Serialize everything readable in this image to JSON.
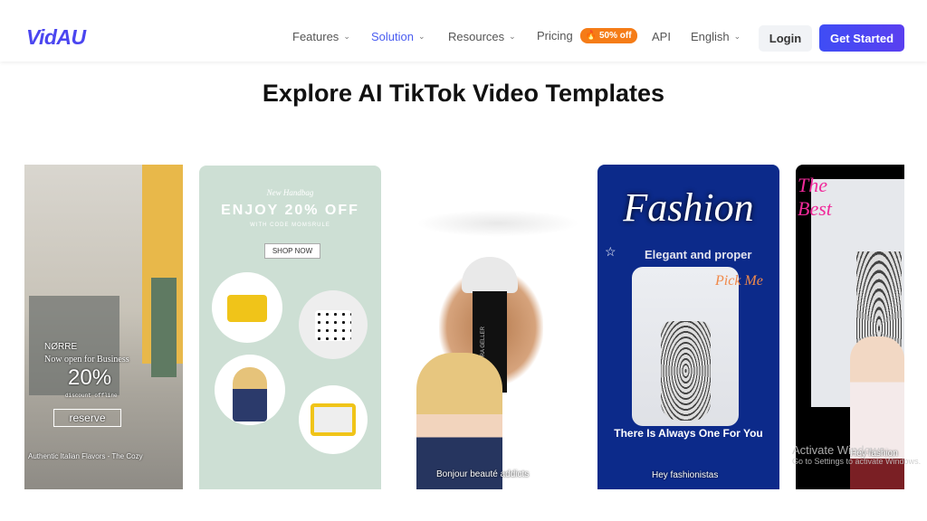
{
  "header": {
    "logo": "VidAU",
    "nav": [
      {
        "label": "Features"
      },
      {
        "label": "Solution"
      },
      {
        "label": "Resources"
      },
      {
        "label": "Pricing",
        "badge": "50% off"
      },
      {
        "label": "API"
      },
      {
        "label": "English"
      }
    ],
    "login": "Login",
    "get_started": "Get Started"
  },
  "page_title": "Explore AI TikTok Video Templates",
  "colors": {
    "accent": "#4b46f0",
    "badge": "#f57c17",
    "fashion_bg": "#0c2a8a",
    "handbag_bg": "#cddfd4"
  },
  "templates": [
    {
      "brand": "NØRRE",
      "headline": "Now open for Business",
      "discount": "20%",
      "discount_note": "discount offline",
      "button": "reserve",
      "caption": "Authentic Italian Flavors - The Cozy"
    },
    {
      "script": "New Handbag",
      "headline": "ENJOY 20% OFF",
      "sub": "WITH CODE MOMSRULE",
      "button": "SHOP NOW"
    },
    {
      "product": "LAURA GELLER",
      "caption": "Bonjour beauté addicts"
    },
    {
      "title": "Fashion",
      "tagline": "Elegant and proper",
      "script": "Pick Me",
      "headline": "There Is Always One For You",
      "caption": "Hey fashionistas"
    },
    {
      "script": "The Best",
      "caption": "Hey fashion"
    }
  ],
  "watermark": {
    "line1": "Activate Windows",
    "line2": "Go to Settings to activate Windows."
  }
}
